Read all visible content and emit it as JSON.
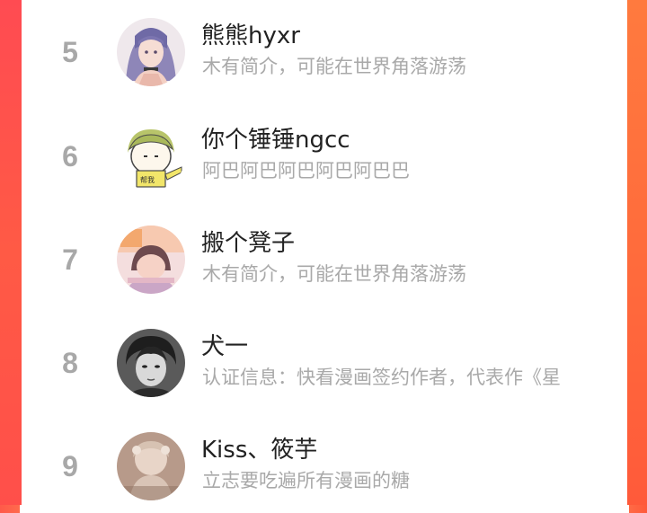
{
  "ranking": {
    "items": [
      {
        "rank": "5",
        "name": "熊熊hyxr",
        "bio": "木有简介，可能在世界角落游荡",
        "avatar_icon": "anime-girl-purple-hair-avatar"
      },
      {
        "rank": "6",
        "name": "你个锤锤ngcc",
        "bio": "阿巴阿巴阿巴阿巴阿巴巴",
        "avatar_icon": "cartoon-green-hair-avatar"
      },
      {
        "rank": "7",
        "name": "搬个凳子",
        "bio": "木有简介，可能在世界角落游荡",
        "avatar_icon": "cartoon-girl-pink-avatar"
      },
      {
        "rank": "8",
        "name": "犬一",
        "bio": "认证信息：快看漫画签约作者，代表作《星",
        "avatar_icon": "monochrome-portrait-avatar"
      },
      {
        "rank": "9",
        "name": "Kiss、筱芋",
        "bio": "立志要吃遍所有漫画的糖",
        "avatar_icon": "sepia-photo-avatar"
      }
    ]
  },
  "colors": {
    "accent_left": "#ff4f4a",
    "accent_right": "#ff6a3c",
    "rank_gray": "#a8a8a8",
    "name_text": "#222222",
    "bio_text": "#a9a9a9"
  }
}
